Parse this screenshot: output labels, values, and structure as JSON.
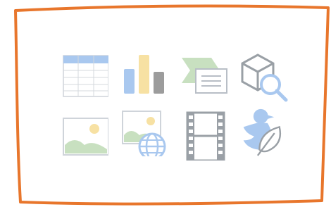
{
  "frame": {
    "border_color": "#e8762c",
    "fill": "#ffffff"
  },
  "icons": [
    {
      "name": "table-icon"
    },
    {
      "name": "bar-chart-icon"
    },
    {
      "name": "slides-icon"
    },
    {
      "name": "3d-search-icon"
    },
    {
      "name": "image-icon"
    },
    {
      "name": "web-image-icon"
    },
    {
      "name": "film-icon"
    },
    {
      "name": "bird-leaf-icon"
    }
  ]
}
